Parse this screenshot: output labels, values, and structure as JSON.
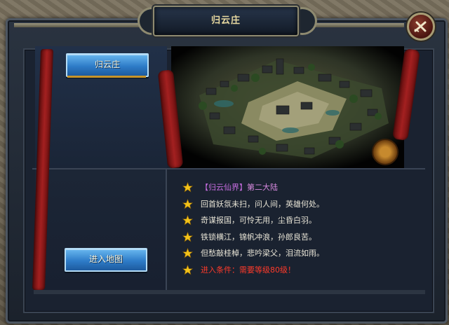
{
  "window": {
    "title": "归云庄"
  },
  "left_panel": {
    "location_button": "归云庄",
    "enter_button": "进入地图"
  },
  "info": {
    "name_part1": "【归云仙界】",
    "name_part2": "第二大陆",
    "lines": [
      "回首妖氛未扫，问人间，英雄何处。",
      "奇谋报国，可怜无用，尘昏白羽。",
      "铁锁横江，锦帆冲浪，孙郎良苦。",
      "但愁敲桂棹，悲吟梁父，泪流如雨。"
    ],
    "condition": "进入条件：需要等级80级！"
  },
  "icons": {
    "close": "close-icon",
    "star": "star-icon",
    "gear": "gear-badge-icon"
  },
  "colors": {
    "name_highlight": "#c66de0",
    "condition_red": "#ff3a2a",
    "button_blue": "#2e7cc8"
  }
}
